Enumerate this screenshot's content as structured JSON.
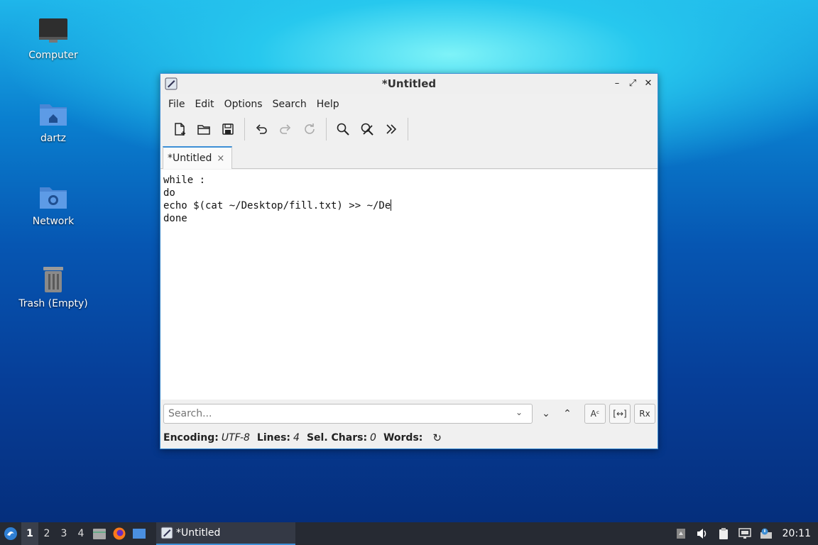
{
  "desktop": {
    "icons": [
      {
        "label": "Computer",
        "icon": "computer-icon"
      },
      {
        "label": "dartz",
        "icon": "home-folder-icon"
      },
      {
        "label": "Network",
        "icon": "network-folder-icon"
      },
      {
        "label": "Trash (Empty)",
        "icon": "trash-icon"
      }
    ]
  },
  "window": {
    "title": "*Untitled",
    "menu": [
      "File",
      "Edit",
      "Options",
      "Search",
      "Help"
    ],
    "toolbar": [
      "new-file-icon",
      "open-icon",
      "save-icon",
      "undo-icon",
      "redo-icon",
      "reload-icon",
      "find-icon",
      "replace-icon",
      "more-icon"
    ],
    "tab": {
      "label": "*Untitled",
      "close": "×"
    },
    "editor": {
      "lines": [
        "while :",
        "do",
        "echo $(cat ~/Desktop/fill.txt) >> ~/De",
        "done"
      ]
    },
    "search": {
      "placeholder": "Search...",
      "btn_down": "⌄",
      "btn_up": "⌃",
      "btn_case": "Aᶜ",
      "btn_whole": "[↔]",
      "btn_regex": "Rx"
    },
    "status": {
      "encoding_label": "Encoding:",
      "encoding_value": "UTF-8",
      "lines_label": "Lines:",
      "lines_value": "4",
      "sel_label": "Sel. Chars:",
      "sel_value": "0",
      "words_label": "Words:"
    }
  },
  "taskbar": {
    "workspaces": [
      "1",
      "2",
      "3",
      "4"
    ],
    "active_task": "*Untitled",
    "clock": "20:11"
  },
  "colors": {
    "accent": "#3d8fd6",
    "taskbar": "#262a33"
  }
}
